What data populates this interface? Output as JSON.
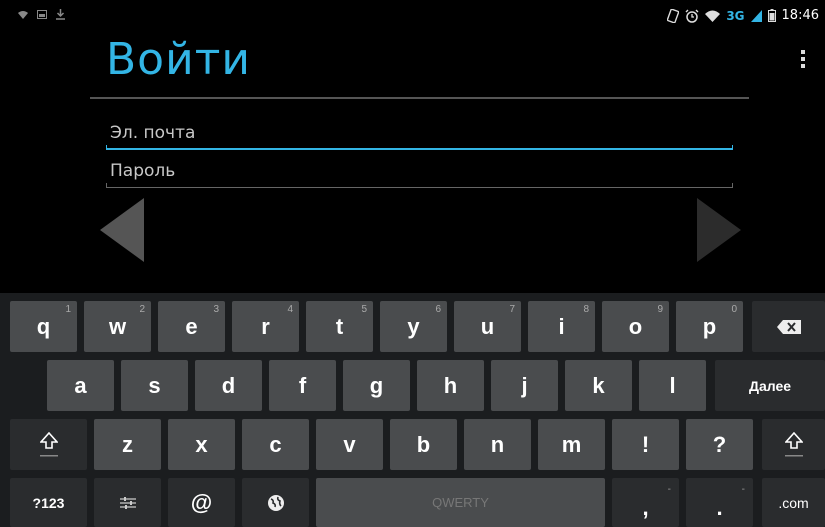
{
  "status_bar": {
    "time": "18:46",
    "network": "3G"
  },
  "title": "Войти",
  "form": {
    "email_placeholder": "Эл. почта",
    "password_placeholder": "Пароль"
  },
  "keyboard": {
    "row1": [
      {
        "k": "q",
        "n": "1"
      },
      {
        "k": "w",
        "n": "2"
      },
      {
        "k": "e",
        "n": "3"
      },
      {
        "k": "r",
        "n": "4"
      },
      {
        "k": "t",
        "n": "5"
      },
      {
        "k": "y",
        "n": "6"
      },
      {
        "k": "u",
        "n": "7"
      },
      {
        "k": "i",
        "n": "8"
      },
      {
        "k": "o",
        "n": "9"
      },
      {
        "k": "p",
        "n": "0"
      }
    ],
    "row2": [
      "a",
      "s",
      "d",
      "f",
      "g",
      "h",
      "j",
      "k",
      "l"
    ],
    "row3": [
      "z",
      "x",
      "c",
      "v",
      "b",
      "n",
      "m",
      "!",
      "?"
    ],
    "enter_label": "Далее",
    "symbols_label": "?123",
    "at_label": "@",
    "space_label": "QWERTY",
    "comma_label": ",",
    "period_label": ".",
    "dotcom_label": ".com",
    "colors": {
      "accent": "#33b5e5",
      "key": "#4a4c4e",
      "key_dark": "#2a2c2e"
    }
  }
}
